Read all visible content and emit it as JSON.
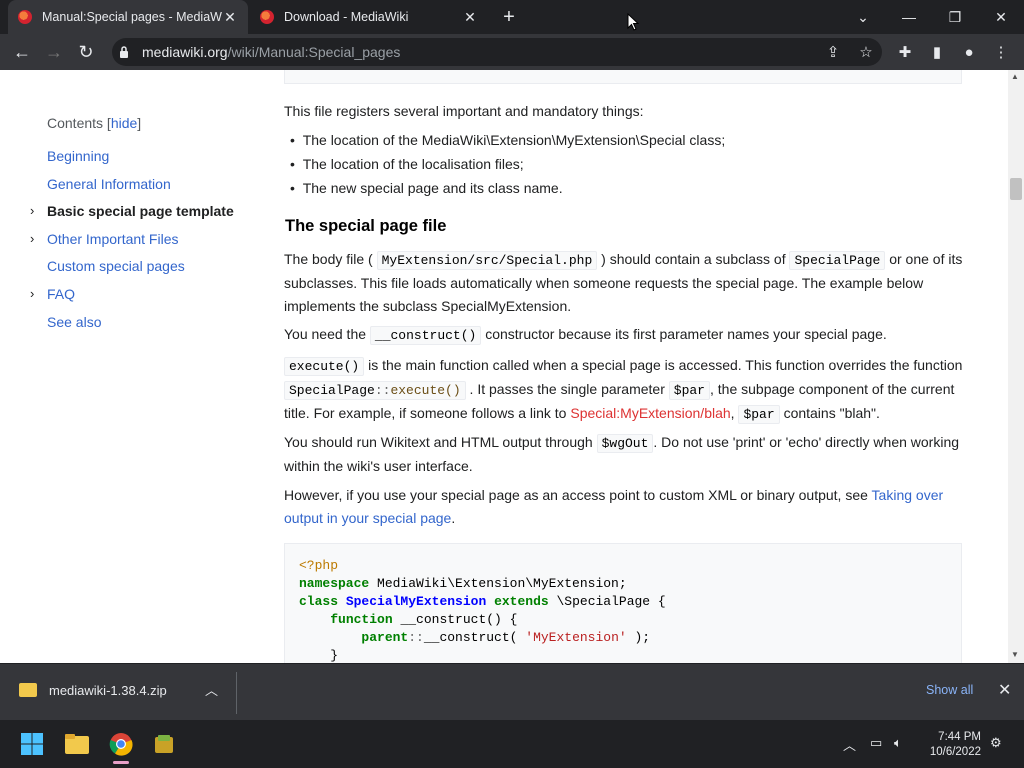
{
  "browser": {
    "tabs": [
      {
        "title": "Manual:Special pages - MediaWiki",
        "active": true
      },
      {
        "title": "Download - MediaWiki",
        "active": false
      }
    ],
    "new_tab": "+",
    "url_domain": "mediawiki.org",
    "url_path": "/wiki/Manual:Special_pages"
  },
  "toc": {
    "title": "Contents",
    "hide_label": "hide",
    "items": [
      {
        "label": "Beginning",
        "bold": false,
        "expandable": false
      },
      {
        "label": "General Information",
        "bold": false,
        "expandable": false
      },
      {
        "label": "Basic special page template",
        "bold": true,
        "expandable": true
      },
      {
        "label": "Other Important Files",
        "bold": false,
        "expandable": true
      },
      {
        "label": "Custom special pages",
        "bold": false,
        "expandable": false
      },
      {
        "label": "FAQ",
        "bold": false,
        "expandable": true
      },
      {
        "label": "See also",
        "bold": false,
        "expandable": false
      }
    ]
  },
  "content": {
    "intro": "This file registers several important and mandatory things:",
    "bullets": [
      "The location of the MediaWiki\\Extension\\MyExtension\\Special class;",
      "The location of the localisation files;",
      "The new special page and its class name."
    ],
    "heading": "The special page file",
    "p1_a": "The body file (",
    "p1_code1": "MyExtension/src/Special.php",
    "p1_b": ") should contain a subclass of",
    "p1_code2": "SpecialPage",
    "p1_c": "or one of its",
    "p1_d": "subclasses. This file loads automatically when someone requests the special page. The example below",
    "p1_e": "implements the subclass SpecialMyExtension.",
    "p2_a": "You need the",
    "p2_code": "__construct()",
    "p2_b": "constructor because its first parameter names your special page.",
    "p3_code1": "execute()",
    "p3_a": "is the main function called when a special page is accessed. This function overrides the function",
    "p3_code2a": "SpecialPage",
    "p3_code2b": "::",
    "p3_code2c": "execute()",
    "p3_b": ". It passes the single parameter",
    "p3_code3": "$par",
    "p3_c": ", the subpage component of the current",
    "p3_d": "title. For example, if someone follows a link to",
    "p3_link": "Special:MyExtension/blah",
    "p3_code4": "$par",
    "p3_e": "contains \"blah\".",
    "p4_a": "You should run Wikitext and HTML output through",
    "p4_code": "$wgOut",
    "p4_b": ". Do not use 'print' or 'echo' directly when working",
    "p4_c": "within the wiki's user interface.",
    "p5_a": "However, if you use your special page as an access point to custom XML or binary output, see",
    "p5_link1": "Taking over",
    "p5_link2": "output in your special page",
    "p5_b": "."
  },
  "code": {
    "l1": "<?php",
    "l2_kw": "namespace",
    "l2_rest": " MediaWiki\\Extension\\MyExtension;",
    "l3_kw": "class",
    "l3_cls": "SpecialMyExtension",
    "l3_kw2": "extends",
    "l3_rest": " \\SpecialPage {",
    "l4_kw": "function",
    "l4_rest": " __construct() {",
    "l5_kw": "parent",
    "l5_op": "::",
    "l5_fn": "__construct( ",
    "l5_str": "'MyExtension'",
    "l5_end": " );",
    "l6": "}"
  },
  "download": {
    "file": "mediawiki-1.38.4.zip",
    "show_all": "Show all"
  },
  "taskbar": {
    "time": "7:44 PM",
    "date": "10/6/2022"
  },
  "colors": {
    "link": "#3366cc",
    "redlink": "#dd3333",
    "chrome_dark": "#202124",
    "chrome_mid": "#35363a"
  }
}
